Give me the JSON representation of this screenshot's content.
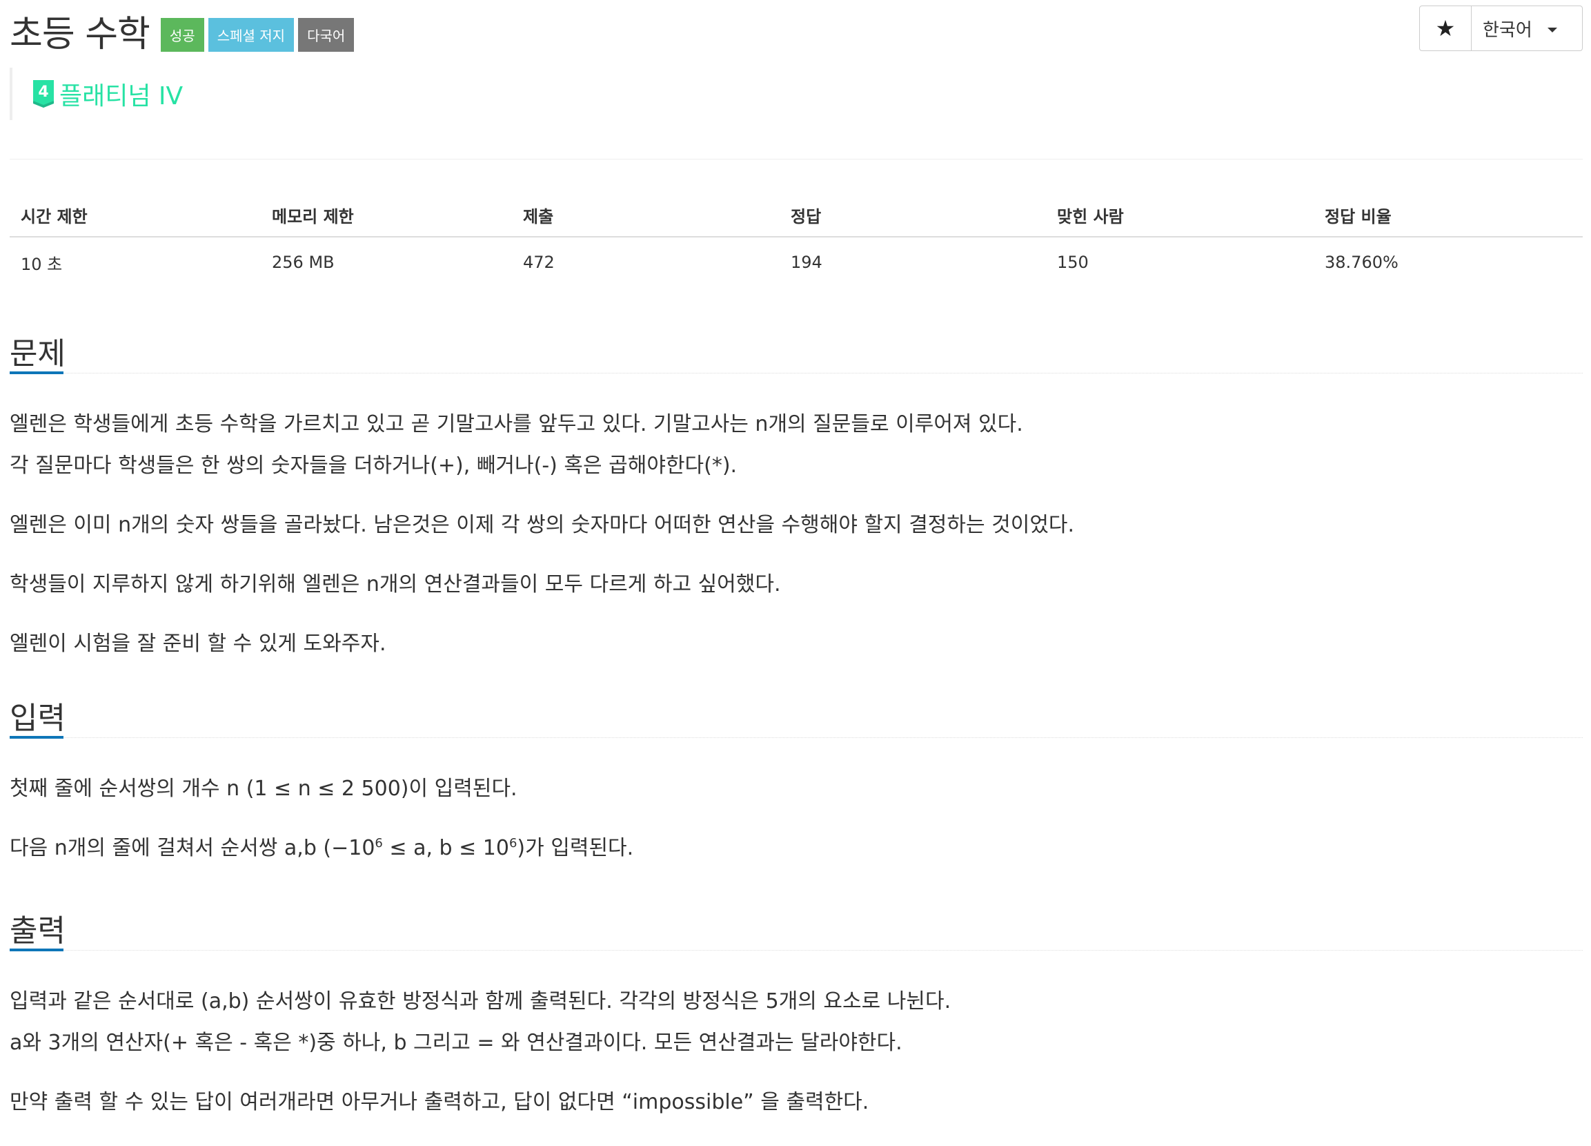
{
  "problem": {
    "title": "초등 수학",
    "labels": [
      {
        "text": "성공",
        "color": "#5cb85c"
      },
      {
        "text": "스페셜 저지",
        "color": "#5bc0de"
      },
      {
        "text": "다국어",
        "color": "#777777"
      }
    ],
    "tier": {
      "badge_number": "4",
      "text": "플래티넘 IV",
      "color": "#27e2a4"
    }
  },
  "toolbar": {
    "star_icon": "★",
    "language": "한국어"
  },
  "stats": {
    "headers": [
      "시간 제한",
      "메모리 제한",
      "제출",
      "정답",
      "맞힌 사람",
      "정답 비율"
    ],
    "values": [
      "10 초",
      "256 MB",
      "472",
      "194",
      "150",
      "38.760%"
    ]
  },
  "sections": {
    "problem": {
      "title": "문제",
      "p1_line1": "엘렌은 학생들에게 초등 수학을 가르치고 있고 곧 기말고사를 앞두고 있다. 기말고사는 n개의 질문들로 이루어져 있다.",
      "p1_line2": "각 질문마다 학생들은 한 쌍의 숫자들을 더하거나(+), 빼거나(-) 혹은 곱해야한다(*).",
      "p2": "엘렌은 이미 n개의 숫자 쌍들을 골라놨다. 남은것은 이제 각 쌍의 숫자마다 어떠한 연산을 수행해야 할지 결정하는 것이었다.",
      "p3": "학생들이 지루하지 않게 하기위해 엘렌은 n개의 연산결과들이 모두 다르게 하고 싶어했다.",
      "p4": "엘렌이 시험을 잘 준비 할 수 있게 도와주자."
    },
    "input": {
      "title": "입력",
      "p1": "첫째 줄에 순서쌍의 개수 n (1 ≤ n ≤ 2 500)이 입력된다.",
      "p2_a": "다음 n개의 줄에 걸쳐서 순서쌍 a,b (−10",
      "p2_sup1": "6",
      "p2_b": " ≤ a, b ≤ 10",
      "p2_sup2": "6",
      "p2_c": ")가 입력된다."
    },
    "output": {
      "title": "출력",
      "p1_line1": "입력과 같은 순서대로 (a,b) 순서쌍이 유효한 방정식과 함께 출력된다. 각각의 방정식은 5개의 요소로 나뉜다.",
      "p1_line2": "a와 3개의 연산자(+ 혹은 - 혹은  *)중 하나, b 그리고 = 와 연산결과이다. 모든 연산결과는 달라야한다.",
      "p2": "만약 출력 할 수 있는 답이 여러개라면 아무거나 출력하고, 답이 없다면 “impossible” 을 출력한다."
    }
  }
}
